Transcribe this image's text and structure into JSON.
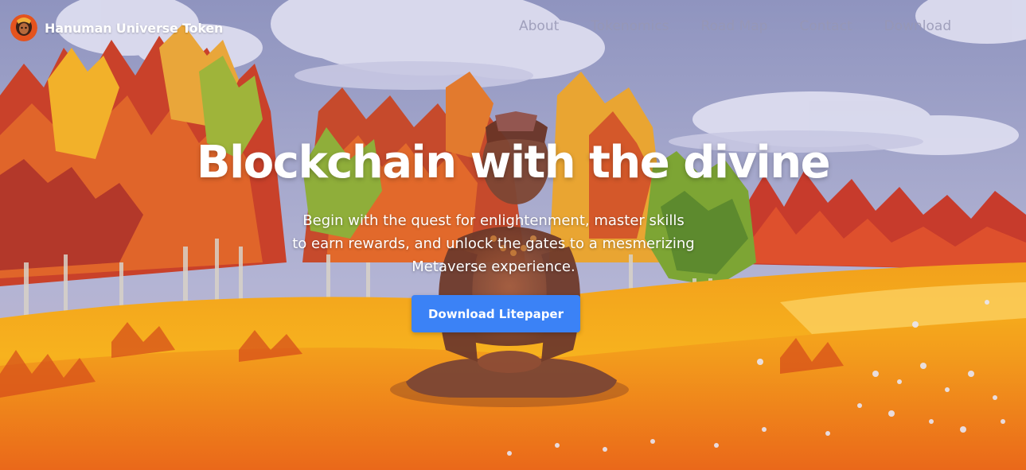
{
  "brand": {
    "logo_icon": "hanuman-avatar-icon",
    "name": "Hanuman  Universe Token"
  },
  "nav": {
    "items": [
      {
        "label": "About"
      },
      {
        "label": "Tokenomics"
      },
      {
        "label": "Road Map"
      },
      {
        "label": "Contact"
      },
      {
        "label": "Download"
      }
    ]
  },
  "hero": {
    "title": "Blockchain with the divine",
    "subtitle_lines": [
      "Begin with the quest for enlightenment, master skills",
      "to earn rewards, and unlock the gates to a mesmerizing",
      "Metaverse experience."
    ],
    "cta_label": "Download Litepaper"
  },
  "colors": {
    "cta_background": "#3b82f6",
    "text": "#ffffff"
  }
}
